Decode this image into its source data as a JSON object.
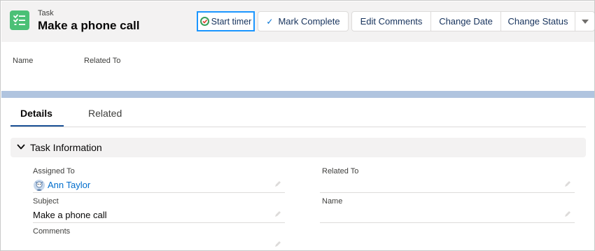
{
  "header": {
    "object_type": "Task",
    "title": "Make a phone call",
    "icon": "task-checklist-icon",
    "icon_color": "#4bc076"
  },
  "actions": {
    "start_timer": "Start timer",
    "mark_complete": "Mark Complete",
    "edit_comments": "Edit Comments",
    "change_date": "Change Date",
    "change_status": "Change Status",
    "more_icon": "chevron-down-icon"
  },
  "highlights": {
    "fields": [
      "Name",
      "Related To"
    ]
  },
  "tabs": [
    {
      "label": "Details",
      "active": true
    },
    {
      "label": "Related",
      "active": false
    }
  ],
  "section": {
    "title": "Task Information"
  },
  "fields": {
    "assigned_to": {
      "label": "Assigned To",
      "value": "Ann Taylor"
    },
    "related_to": {
      "label": "Related To",
      "value": ""
    },
    "subject": {
      "label": "Subject",
      "value": "Make a phone call"
    },
    "name": {
      "label": "Name",
      "value": ""
    },
    "comments": {
      "label": "Comments",
      "value": ""
    }
  },
  "colors": {
    "accent": "#1b96ff",
    "link": "#006dcc",
    "band": "#b0c4df"
  }
}
